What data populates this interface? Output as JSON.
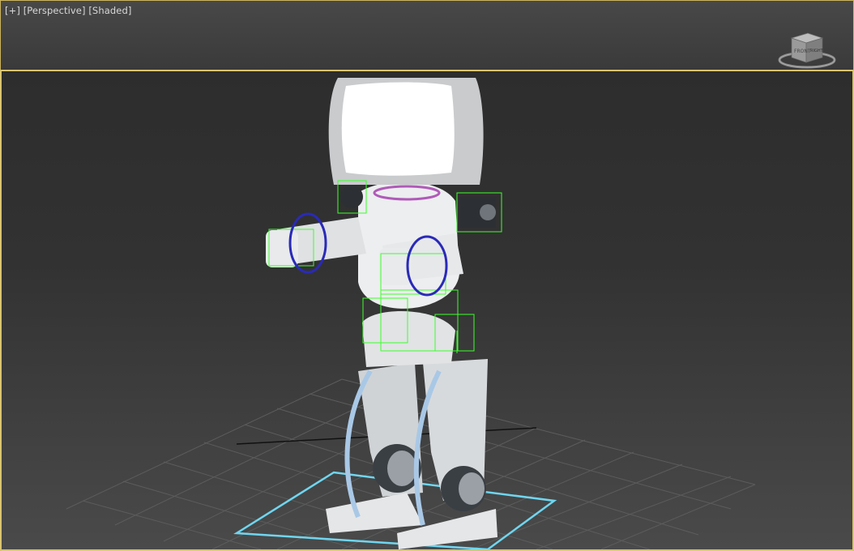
{
  "viewport_top": {
    "label_plus": "[+]",
    "label_view": "[Perspective]",
    "label_shading": "[Shaded]",
    "viewcube_face": "FRONT",
    "viewcube_corner": "RIGHT"
  },
  "viewport_main": {
    "scene": "robot character with rig controls",
    "selection_color": "#4fd0ff",
    "bone_box_color": "#3cff2a",
    "ik_ring_color": "#2a2ab8"
  },
  "colors": {
    "frame_active": "#d9c470",
    "background_top": "#2d2d2d",
    "background_bottom": "#4a4a4a",
    "grid": "#5a5a5a"
  }
}
